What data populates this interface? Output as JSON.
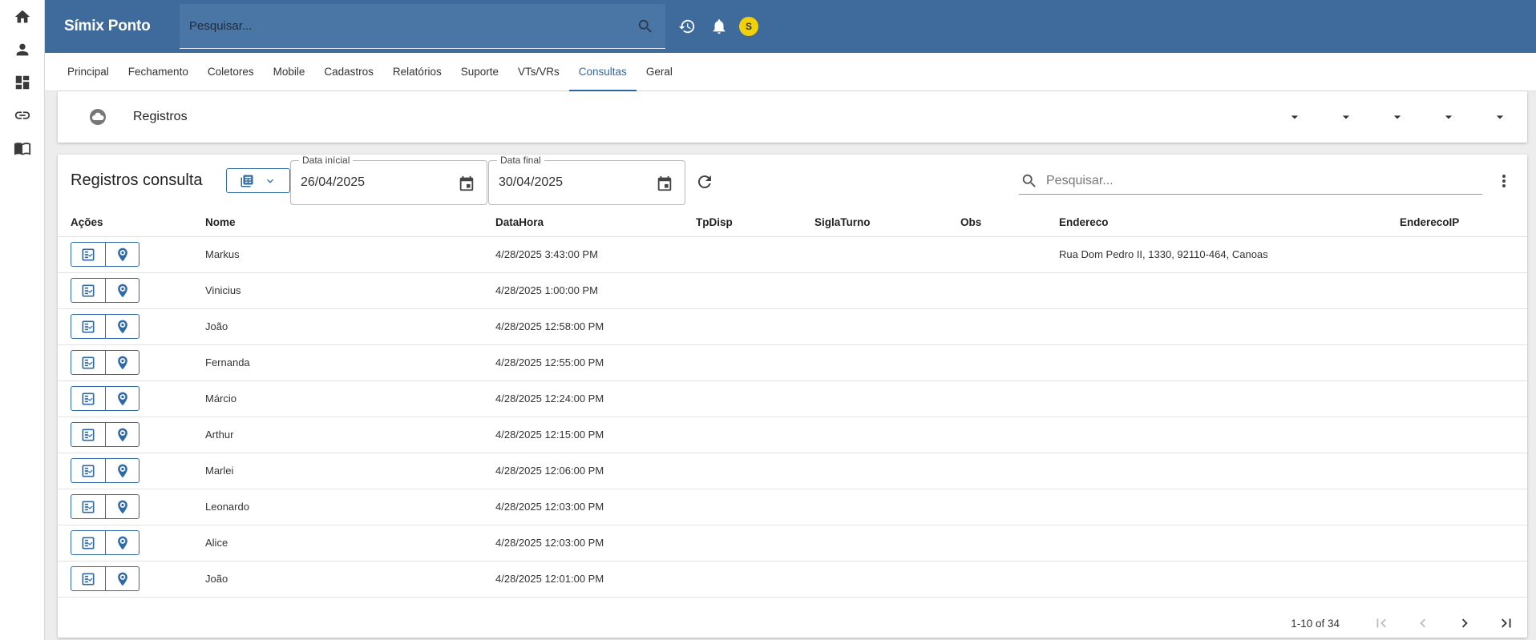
{
  "app": {
    "title": "Símix Ponto"
  },
  "header": {
    "search_placeholder": "Pesquisar...",
    "avatar_letter": "S"
  },
  "tabs": [
    {
      "label": "Principal"
    },
    {
      "label": "Fechamento"
    },
    {
      "label": "Coletores"
    },
    {
      "label": "Mobile"
    },
    {
      "label": "Cadastros"
    },
    {
      "label": "Relatórios"
    },
    {
      "label": "Suporte"
    },
    {
      "label": "VTs/VRs"
    },
    {
      "label": "Consultas",
      "active": true
    },
    {
      "label": "Geral"
    }
  ],
  "panel": {
    "title": "Registros"
  },
  "grid": {
    "title": "Registros consulta",
    "date_start_label": "Data inícial",
    "date_start": "26/04/2025",
    "date_end_label": "Data final",
    "date_end": "30/04/2025",
    "search_placeholder": "Pesquisar...",
    "columns": [
      "Ações",
      "Nome",
      "DataHora",
      "TpDisp",
      "SiglaTurno",
      "Obs",
      "Endereco",
      "EnderecoIP"
    ],
    "rows": [
      {
        "nome": "Markus",
        "datahora": "4/28/2025 3:43:00 PM",
        "endereco": "Rua Dom Pedro II, 1330, 92110-464, Canoas"
      },
      {
        "nome": "Vinicius",
        "datahora": "4/28/2025 1:00:00 PM",
        "endereco": ""
      },
      {
        "nome": "João",
        "datahora": "4/28/2025 12:58:00 PM",
        "endereco": ""
      },
      {
        "nome": "Fernanda",
        "datahora": "4/28/2025 12:55:00 PM",
        "endereco": ""
      },
      {
        "nome": "Márcio",
        "datahora": "4/28/2025 12:24:00 PM",
        "endereco": ""
      },
      {
        "nome": "Arthur",
        "datahora": "4/28/2025 12:15:00 PM",
        "endereco": ""
      },
      {
        "nome": "Marlei",
        "datahora": "4/28/2025 12:06:00 PM",
        "endereco": ""
      },
      {
        "nome": "Leonardo",
        "datahora": "4/28/2025 12:03:00 PM",
        "endereco": ""
      },
      {
        "nome": "Alice",
        "datahora": "4/28/2025 12:03:00 PM",
        "endereco": ""
      },
      {
        "nome": "João",
        "datahora": "4/28/2025 12:01:00 PM",
        "endereco": ""
      }
    ],
    "pager_info": "1-10 of 34"
  },
  "colors": {
    "primary": "#3e6b9c",
    "accent": "#2f6aa7",
    "avatar": "#f3d10a"
  },
  "icons": {
    "rail": [
      "home-icon",
      "person-icon",
      "dashboard-icon",
      "link-icon",
      "book-icon"
    ],
    "row_actions": [
      "checklist-icon",
      "location-pin-icon"
    ]
  }
}
